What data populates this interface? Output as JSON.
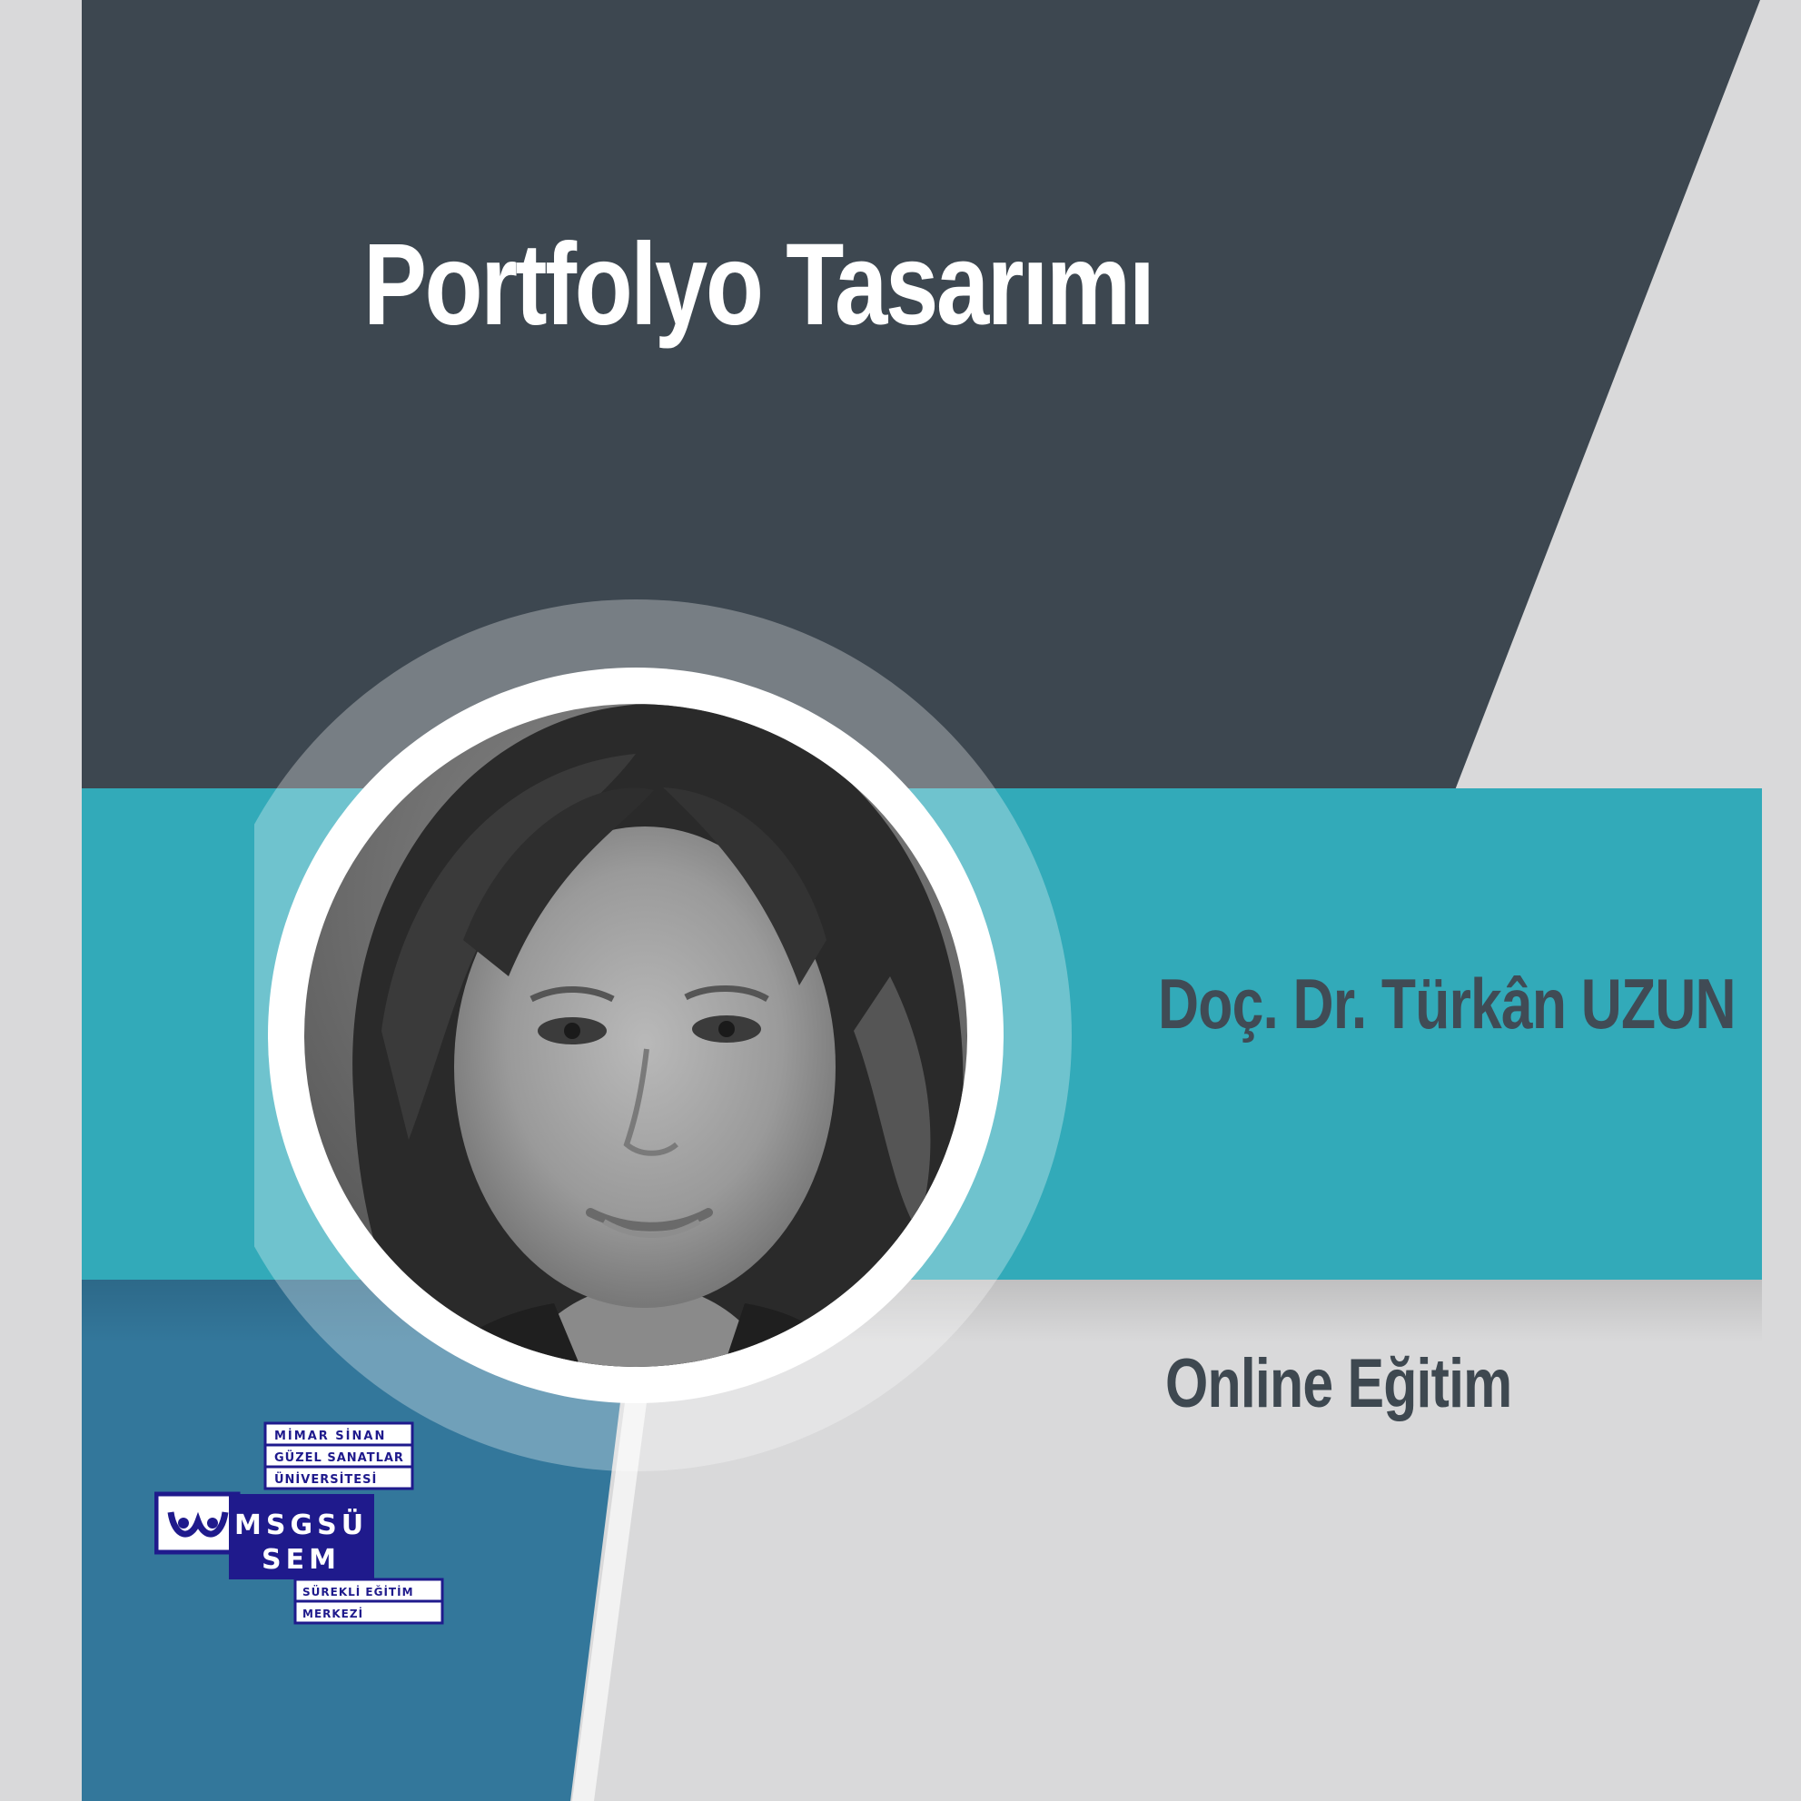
{
  "course": {
    "title": "Portfolyo Tasarımı",
    "mode": "Online Eğitim"
  },
  "instructor": {
    "name": "Doç. Dr. Türkân UZUN"
  },
  "logo": {
    "line1": "MİMAR SİNAN",
    "line2": "GÜZEL SANATLAR",
    "line3": "ÜNİVERSİTESİ",
    "mark1": "MSGSÜ",
    "mark2": "SEM",
    "line4": "SÜREKLİ EĞİTİM",
    "line5": "MERKEZİ"
  },
  "colors": {
    "dark_panel": "#3d4750",
    "teal_band": "#32aab9",
    "blue_panel": "#33779b",
    "light_bg": "#d9d9da",
    "logo_navy": "#1f1a8c"
  }
}
